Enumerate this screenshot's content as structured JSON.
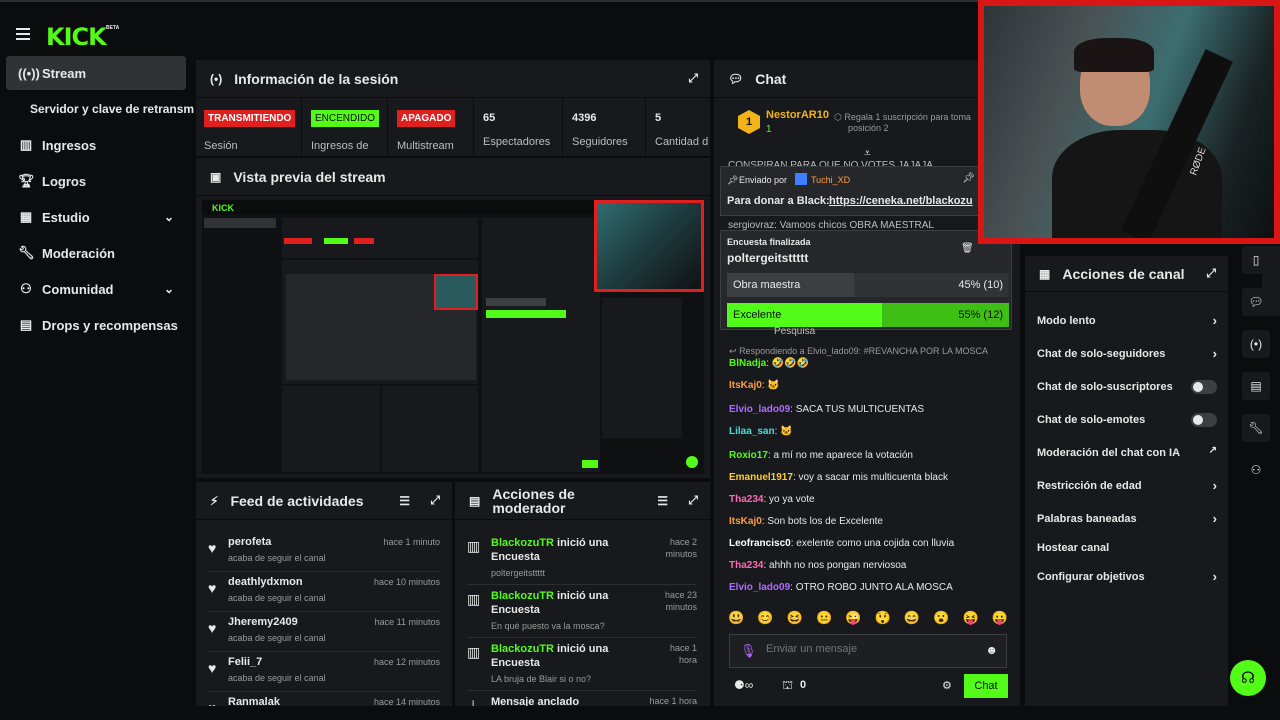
{
  "brand": {
    "logo": "KICK",
    "beta": "BETA",
    "accent": "#53fc18"
  },
  "sidebar": {
    "items": [
      {
        "label": "Stream",
        "icon": "broadcast-icon"
      },
      {
        "label": "Servidor y clave de retransmi"
      },
      {
        "label": "Ingresos",
        "icon": "chart-icon"
      },
      {
        "label": "Logros",
        "icon": "trophy-icon"
      },
      {
        "label": "Estudio",
        "icon": "studio-icon"
      },
      {
        "label": "Moderación",
        "icon": "wrench-icon"
      },
      {
        "label": "Comunidad",
        "icon": "community-icon"
      },
      {
        "label": "Drops y recompensas",
        "icon": "drops-icon"
      }
    ]
  },
  "session": {
    "title": "Información de la sesión",
    "stats": [
      {
        "badge": "TRANSMITIENDO",
        "label": "Sesión"
      },
      {
        "badge": "ENCENDIDO",
        "label": "Ingresos de"
      },
      {
        "badge": "APAGADO",
        "label": "Multistream"
      },
      {
        "value": "65",
        "label": "Espectadores"
      },
      {
        "value": "4396",
        "label": "Seguidores"
      },
      {
        "value": "5",
        "label": "Cantidad d"
      }
    ]
  },
  "preview": {
    "title": "Vista previa del stream"
  },
  "feed": {
    "title": "Feed de actividades",
    "items": [
      {
        "user": "perofeta",
        "action": "acaba de seguir el canal",
        "time": "hace 1 minuto"
      },
      {
        "user": "deathlydxmon",
        "action": "acaba de seguir el canal",
        "time": "hace 10 minutos"
      },
      {
        "user": "Jheremy2409",
        "action": "acaba de seguir el canal",
        "time": "hace 11 minutos"
      },
      {
        "user": "Felii_7",
        "action": "acaba de seguir el canal",
        "time": "hace 12 minutos"
      },
      {
        "user": "Ranmalak",
        "action": "",
        "time": "hace 14 minutos"
      }
    ]
  },
  "modactions": {
    "title_1": "Acciones de",
    "title_2": "moderador",
    "items": [
      {
        "user": "BlackozuTR",
        "verb": "inició una",
        "obj": "Encuesta",
        "detail": "poltergeitsttttt",
        "time_1": "hace 2",
        "time_2": "minutos"
      },
      {
        "user": "BlackozuTR",
        "verb": "inició una",
        "obj": "Encuesta",
        "detail": "En qué puesto va la mosca?",
        "time_1": "hace 23",
        "time_2": "minutos"
      },
      {
        "user": "BlackozuTR",
        "verb": "inició una",
        "obj": "Encuesta",
        "detail": "LA bruja de Blair si o no?",
        "time_1": "hace 1",
        "time_2": "hora"
      },
      {
        "user": "",
        "verb": "Mensaje anclado",
        "obj": "",
        "detail": "",
        "time_1": "hace 1 hora",
        "time_2": ""
      }
    ]
  },
  "chat": {
    "title": "Chat",
    "top_user": "NestorAR10",
    "top_rank": "1",
    "top_count": "1",
    "gift_text_1": "Regala 1 suscripción para toma",
    "gift_text_2": "posición 2",
    "scroll_text": "CONSPIRAN PARA QUE NO VOTES JAJAJA",
    "pinned_by": "Enviado por",
    "pinned_user": "Tuchi_XD",
    "pinned_msg": "Para donar a Black:",
    "pinned_link": "https://ceneka.net/blackozu",
    "behind_line": "sergiovraz: Vamoos chicos OBRA MAESTRAL",
    "poll": {
      "header": "Encuesta finalizada",
      "question": "poltergeitsttttt",
      "options": [
        {
          "label": "Obra maestra",
          "result": "45% (10)",
          "percent": 45
        },
        {
          "label": "Excelente",
          "result": "55% (12)",
          "percent": 55
        }
      ]
    },
    "behind_line2": "Pesquisa",
    "reply": "Respondiendo a Elvio_lado09: #REVANCHA POR LA MOSCA",
    "messages": [
      {
        "user": "BlNadja",
        "text": ": 🤣🤣🤣",
        "color": "#53fc18"
      },
      {
        "user": "ItsKaj0",
        "text": ": 🐱",
        "color": "#ff9d3a"
      },
      {
        "user": "Elvio_lado09",
        "text": ": SACA TUS MULTICUENTAS",
        "color": "#b06bff"
      },
      {
        "user": "Lilaa_san",
        "text": ": 🐱",
        "color": "#44e0d8"
      },
      {
        "user": "Roxio17",
        "text": ": a mí no me aparece la votación",
        "color": "#53fc18"
      },
      {
        "user": "Emanuel1917",
        "text": ": voy a sacar mis multicuenta black",
        "color": "#ffcc33"
      },
      {
        "user": "Tha234",
        "text": ": yo ya vote",
        "color": "#ff69b4"
      },
      {
        "user": "ItsKaj0",
        "text": ": Son bots los de Excelente",
        "color": "#ff9d3a"
      },
      {
        "user": "Leofrancisc0",
        "text": ": exelente como una cojida con lluvia",
        "color": "#ffffff"
      },
      {
        "user": "Tha234",
        "text": ": ahhh no nos pongan nerviosoa",
        "color": "#ff69b4"
      },
      {
        "user": "Elvio_lado09",
        "text": ": OTRO ROBO JUNTO ALA MOSCA",
        "color": "#b06bff"
      }
    ],
    "input_placeholder": "Enviar un mensaje",
    "points": "0",
    "send_label": "Chat",
    "emotes": [
      "😃",
      "😊",
      "😆",
      "😐",
      "😜",
      "😲",
      "😄",
      "😮",
      "😝",
      "😛"
    ]
  },
  "canal": {
    "title": "Acciones de canal",
    "items": [
      {
        "label": "Modo lento",
        "type": "arrow"
      },
      {
        "label": "Chat de solo-seguidores",
        "type": "arrow"
      },
      {
        "label": "Chat de solo-suscriptores",
        "type": "toggle"
      },
      {
        "label": "Chat de solo-emotes",
        "type": "toggle"
      },
      {
        "label": "Moderación del chat con IA",
        "type": "external"
      },
      {
        "label": "Restricción de edad",
        "type": "arrow"
      },
      {
        "label": "Palabras baneadas",
        "type": "arrow"
      },
      {
        "label": "Hostear canal",
        "type": "none"
      },
      {
        "label": "Configurar objetivos",
        "type": "arrow"
      }
    ]
  },
  "camera": {
    "mic_brand": "RØDE"
  }
}
